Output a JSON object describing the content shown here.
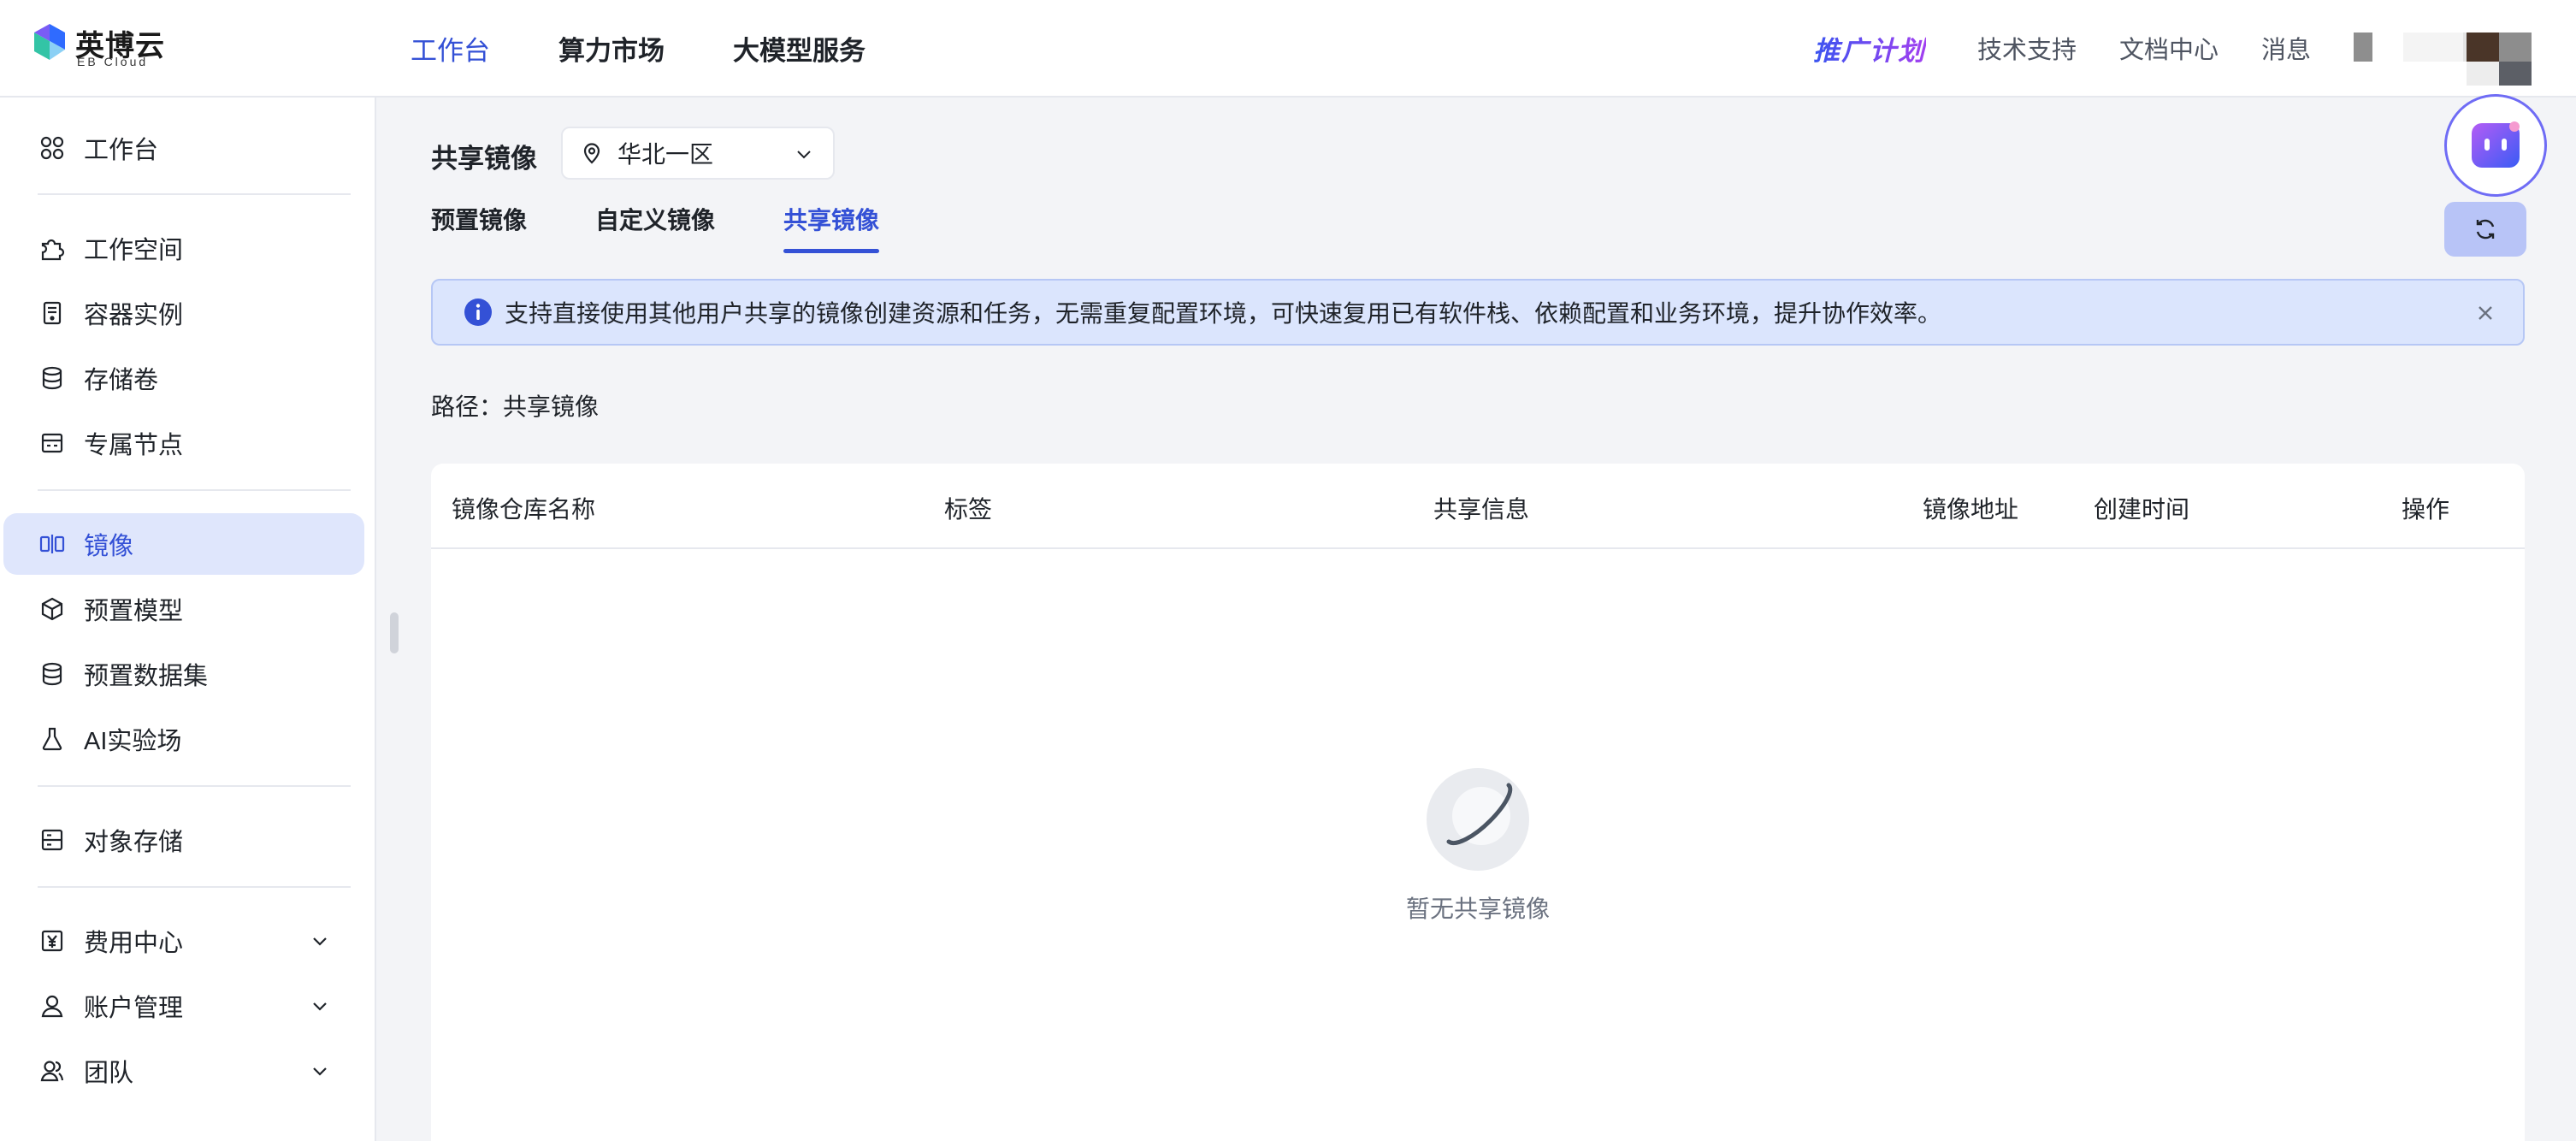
{
  "brand": {
    "name": "英博云",
    "sub": "EB Cloud"
  },
  "topnav": [
    {
      "label": "工作台",
      "active": true
    },
    {
      "label": "算力市场",
      "active": false
    },
    {
      "label": "大模型服务",
      "active": false
    }
  ],
  "topright": {
    "promo": "推广计划",
    "links": [
      "技术支持",
      "文档中心",
      "消息"
    ]
  },
  "sidebar": {
    "items": [
      {
        "label": "工作台",
        "icon": "grid-icon"
      },
      {
        "label": "工作空间",
        "icon": "puzzle-icon"
      },
      {
        "label": "容器实例",
        "icon": "container-icon"
      },
      {
        "label": "存储卷",
        "icon": "database-icon"
      },
      {
        "label": "专属节点",
        "icon": "server-icon"
      },
      {
        "label": "镜像",
        "icon": "image-mirror-icon",
        "active": true
      },
      {
        "label": "预置模型",
        "icon": "cube-icon"
      },
      {
        "label": "预置数据集",
        "icon": "dataset-icon"
      },
      {
        "label": "AI实验场",
        "icon": "flask-icon"
      },
      {
        "label": "对象存储",
        "icon": "storage-icon"
      },
      {
        "label": "费用中心",
        "icon": "yen-icon"
      },
      {
        "label": "账户管理",
        "icon": "user-icon"
      },
      {
        "label": "团队",
        "icon": "team-icon"
      }
    ]
  },
  "main": {
    "title": "共享镜像",
    "region": "华北一区",
    "tabs": [
      {
        "label": "预置镜像",
        "active": false
      },
      {
        "label": "自定义镜像",
        "active": false
      },
      {
        "label": "共享镜像",
        "active": true
      }
    ],
    "alert": "支持直接使用其他用户共享的镜像创建资源和任务，无需重复配置环境，可快速复用已有软件栈、依赖配置和业务环境，提升协作效率。",
    "path_label": "路径：",
    "path_value": "共享镜像",
    "table": {
      "columns": [
        "镜像仓库名称",
        "标签",
        "共享信息",
        "镜像地址",
        "创建时间",
        "操作"
      ],
      "rows": [],
      "empty_text": "暂无共享镜像"
    }
  },
  "colors": {
    "accent": "#3451d6",
    "active_bg": "#dfe6fc",
    "alert_bg": "#dbe5fd",
    "page_bg": "#f3f4f7"
  }
}
